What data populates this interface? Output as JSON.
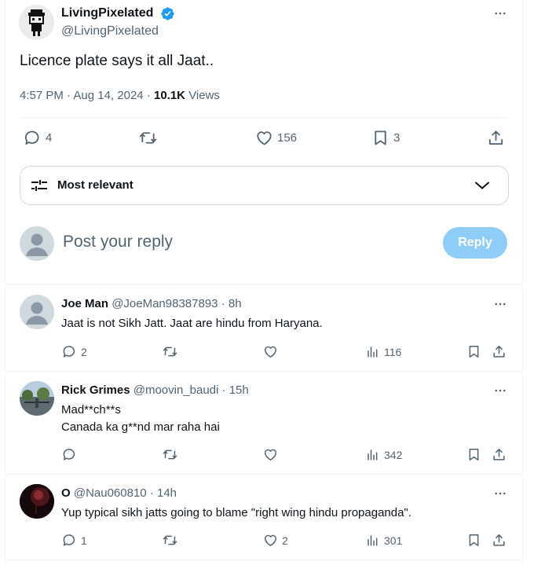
{
  "tweet": {
    "author_name": "LivingPixelated",
    "author_handle": "@LivingPixelated",
    "text": "Licence plate says it all Jaat..",
    "time": "4:57 PM",
    "date": "Aug 14, 2024",
    "views_count": "10.1K",
    "views_label": "Views",
    "stats": {
      "replies": "4",
      "likes": "156",
      "bookmarks": "3"
    }
  },
  "sort": {
    "label": "Most relevant"
  },
  "reply_box": {
    "placeholder": "Post your reply",
    "button_label": "Reply"
  },
  "colors": {
    "accent": "#1d9bf0",
    "reply_disabled": "#8ecdf8",
    "verified": "#1d9bf0",
    "muted": "#536471"
  },
  "replies": [
    {
      "name": "Joe Man",
      "handle": "@JoeMan98387893",
      "time": "8h",
      "lines": [
        "Jaat is not Sikh Jatt. Jaat are hindu from Haryana."
      ],
      "reply_count": "2",
      "like_count": "",
      "views": "116"
    },
    {
      "name": "Rick Grimes",
      "handle": "@moovin_baudi",
      "time": "15h",
      "lines": [
        "Mad**ch**s",
        "Canada ka g**nd mar raha hai"
      ],
      "reply_count": "",
      "like_count": "",
      "views": "342"
    },
    {
      "name": "O",
      "handle": "@Nau060810",
      "time": "14h",
      "lines": [
        "Yup typical sikh jatts going to blame \"right wing hindu propaganda\"."
      ],
      "reply_count": "1",
      "like_count": "2",
      "views": "301"
    }
  ]
}
